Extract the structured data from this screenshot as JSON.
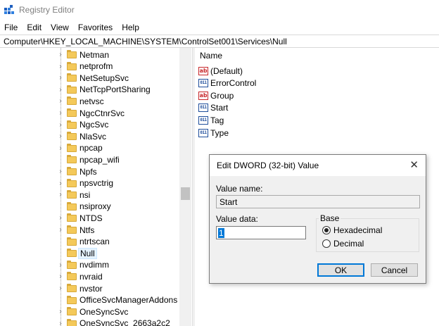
{
  "window": {
    "title": "Registry Editor"
  },
  "menu": [
    "File",
    "Edit",
    "View",
    "Favorites",
    "Help"
  ],
  "address": "Computer\\HKEY_LOCAL_MACHINE\\SYSTEM\\ControlSet001\\Services\\Null",
  "tree": {
    "items": [
      {
        "label": "Netman",
        "expandable": true
      },
      {
        "label": "netprofm",
        "expandable": true
      },
      {
        "label": "NetSetupSvc",
        "expandable": true
      },
      {
        "label": "NetTcpPortSharing",
        "expandable": true
      },
      {
        "label": "netvsc",
        "expandable": true
      },
      {
        "label": "NgcCtnrSvc",
        "expandable": true
      },
      {
        "label": "NgcSvc",
        "expandable": true
      },
      {
        "label": "NlaSvc",
        "expandable": true
      },
      {
        "label": "npcap",
        "expandable": true
      },
      {
        "label": "npcap_wifi",
        "expandable": false
      },
      {
        "label": "Npfs",
        "expandable": true
      },
      {
        "label": "npsvctrig",
        "expandable": true
      },
      {
        "label": "nsi",
        "expandable": true
      },
      {
        "label": "nsiproxy",
        "expandable": false
      },
      {
        "label": "NTDS",
        "expandable": true
      },
      {
        "label": "Ntfs",
        "expandable": true
      },
      {
        "label": "ntrtscan",
        "expandable": false
      },
      {
        "label": "Null",
        "expandable": false,
        "selected": true
      },
      {
        "label": "nvdimm",
        "expandable": true
      },
      {
        "label": "nvraid",
        "expandable": true
      },
      {
        "label": "nvstor",
        "expandable": true
      },
      {
        "label": "OfficeSvcManagerAddons",
        "expandable": false
      },
      {
        "label": "OneSyncSvc",
        "expandable": true
      },
      {
        "label": "OneSyncSvc_2663a2c2",
        "expandable": true
      }
    ]
  },
  "values_pane": {
    "column_header": "Name",
    "rows": [
      {
        "name": "(Default)",
        "icon": "string-value-icon"
      },
      {
        "name": "ErrorControl",
        "icon": "dword-value-icon"
      },
      {
        "name": "Group",
        "icon": "string-value-icon"
      },
      {
        "name": "Start",
        "icon": "dword-value-icon"
      },
      {
        "name": "Tag",
        "icon": "dword-value-icon"
      },
      {
        "name": "Type",
        "icon": "dword-value-icon"
      }
    ]
  },
  "dialog": {
    "title": "Edit DWORD (32-bit) Value",
    "value_name_label": "Value name:",
    "value_name": "Start",
    "value_data_label": "Value data:",
    "value_data": "1",
    "base_label": "Base",
    "radio_hex": "Hexadecimal",
    "radio_dec": "Decimal",
    "selected_base": "Hexadecimal",
    "ok_label": "OK",
    "cancel_label": "Cancel"
  },
  "colors": {
    "selection": "#0078d7",
    "folder": "#f4c95a"
  }
}
